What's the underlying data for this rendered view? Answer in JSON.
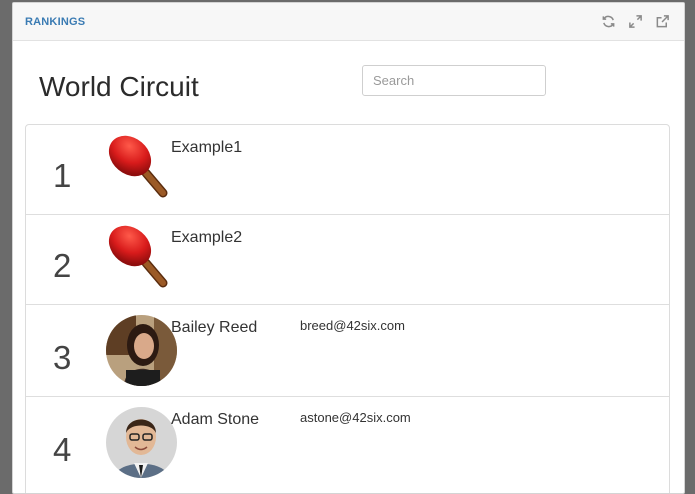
{
  "header": {
    "title": "RANKINGS"
  },
  "icons": {
    "refresh": "refresh-icon",
    "expand": "expand-icon",
    "external": "external-link-icon"
  },
  "page": {
    "title": "World Circuit"
  },
  "search": {
    "placeholder": "Search",
    "value": ""
  },
  "rankings": [
    {
      "rank": "1",
      "name": "Example1",
      "email": "",
      "avatar": "ping-pong-paddle"
    },
    {
      "rank": "2",
      "name": "Example2",
      "email": "",
      "avatar": "ping-pong-paddle"
    },
    {
      "rank": "3",
      "name": "Bailey Reed",
      "email": "breed@42six.com",
      "avatar": "photo"
    },
    {
      "rank": "4",
      "name": "Adam Stone",
      "email": "astone@42six.com",
      "avatar": "photo"
    }
  ],
  "colors": {
    "title_blue": "#3a7bb3",
    "paddle_red": "#d81b1b",
    "handle_brown": "#8b4a1c"
  }
}
